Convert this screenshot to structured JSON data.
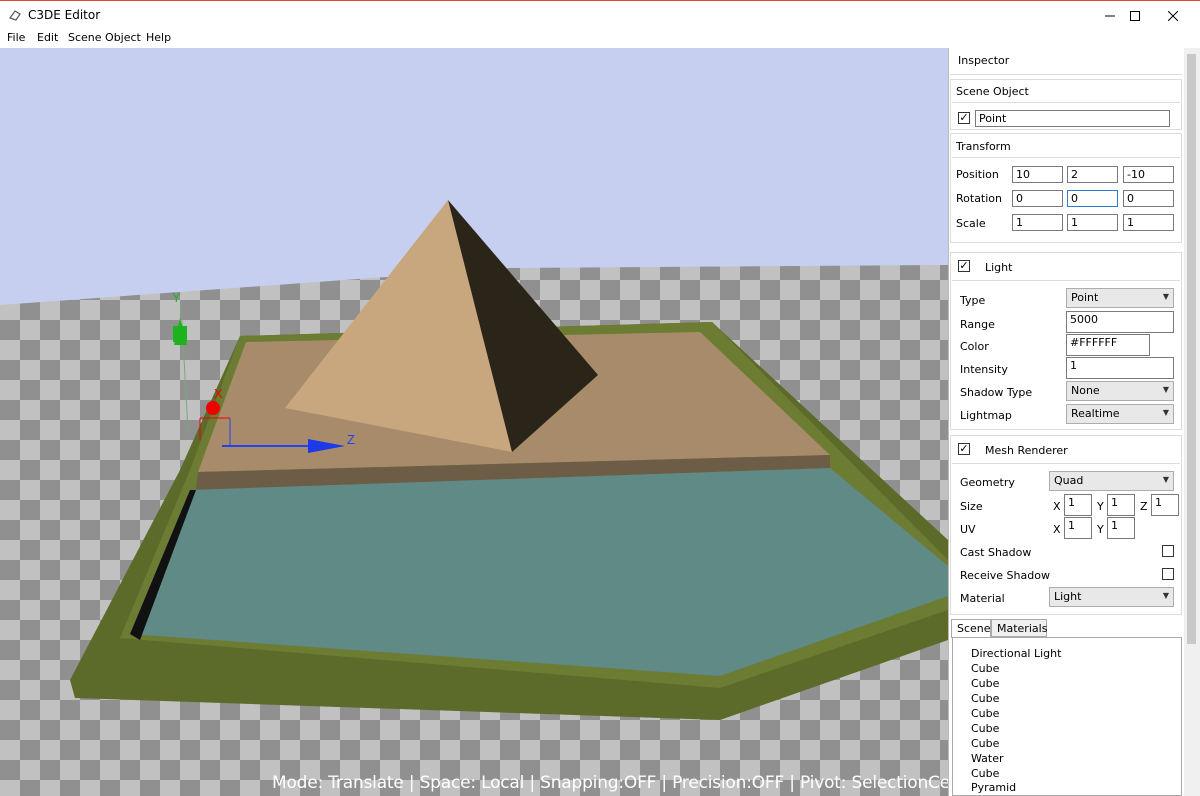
{
  "window": {
    "title": "C3DE Editor"
  },
  "menu": [
    "File",
    "Edit",
    "Scene Object",
    "Help"
  ],
  "viewport": {
    "status": "Mode: Translate | Space: Local | Snapping:OFF | Precision:OFF | Pivot: SelectionCenter",
    "gizmo": {
      "y": "Y",
      "x": "X",
      "z": "Z"
    }
  },
  "inspector": {
    "title": "Inspector",
    "scene_object": {
      "header": "Scene Object",
      "enabled": true,
      "name": "Point"
    },
    "transform": {
      "header": "Transform",
      "position_label": "Position",
      "position": [
        "10",
        "2",
        "-10"
      ],
      "rotation_label": "Rotation",
      "rotation": [
        "0",
        "0",
        "0"
      ],
      "scale_label": "Scale",
      "scale": [
        "1",
        "1",
        "1"
      ]
    },
    "light": {
      "header": "Light",
      "enabled": true,
      "type_label": "Type",
      "type": "Point",
      "range_label": "Range",
      "range": "5000",
      "color_label": "Color",
      "color": "#FFFFFF",
      "intensity_label": "Intensity",
      "intensity": "1",
      "shadow_type_label": "Shadow Type",
      "shadow_type": "None",
      "lightmap_label": "Lightmap",
      "lightmap": "Realtime"
    },
    "mesh_renderer": {
      "header": "Mesh Renderer",
      "enabled": true,
      "geometry_label": "Geometry",
      "geometry": "Quad",
      "size_label": "Size",
      "size": {
        "x": "1",
        "y": "1",
        "z": "1"
      },
      "uv_label": "UV",
      "uv": {
        "x": "1",
        "y": "1"
      },
      "axis_x": "X",
      "axis_y": "Y",
      "axis_z": "Z",
      "cast_shadow_label": "Cast Shadow",
      "cast_shadow": false,
      "receive_shadow_label": "Receive Shadow",
      "receive_shadow": false,
      "material_label": "Material",
      "material": "Light"
    },
    "tabs": [
      "Scene",
      "Materials"
    ],
    "scene_items": [
      "Directional Light",
      "Cube",
      "Cube",
      "Cube",
      "Cube",
      "Cube",
      "Cube",
      "Water",
      "Cube",
      "Pyramid"
    ]
  },
  "colors": {
    "sky": "#c6cfef",
    "accent": "#2d7bd2"
  }
}
